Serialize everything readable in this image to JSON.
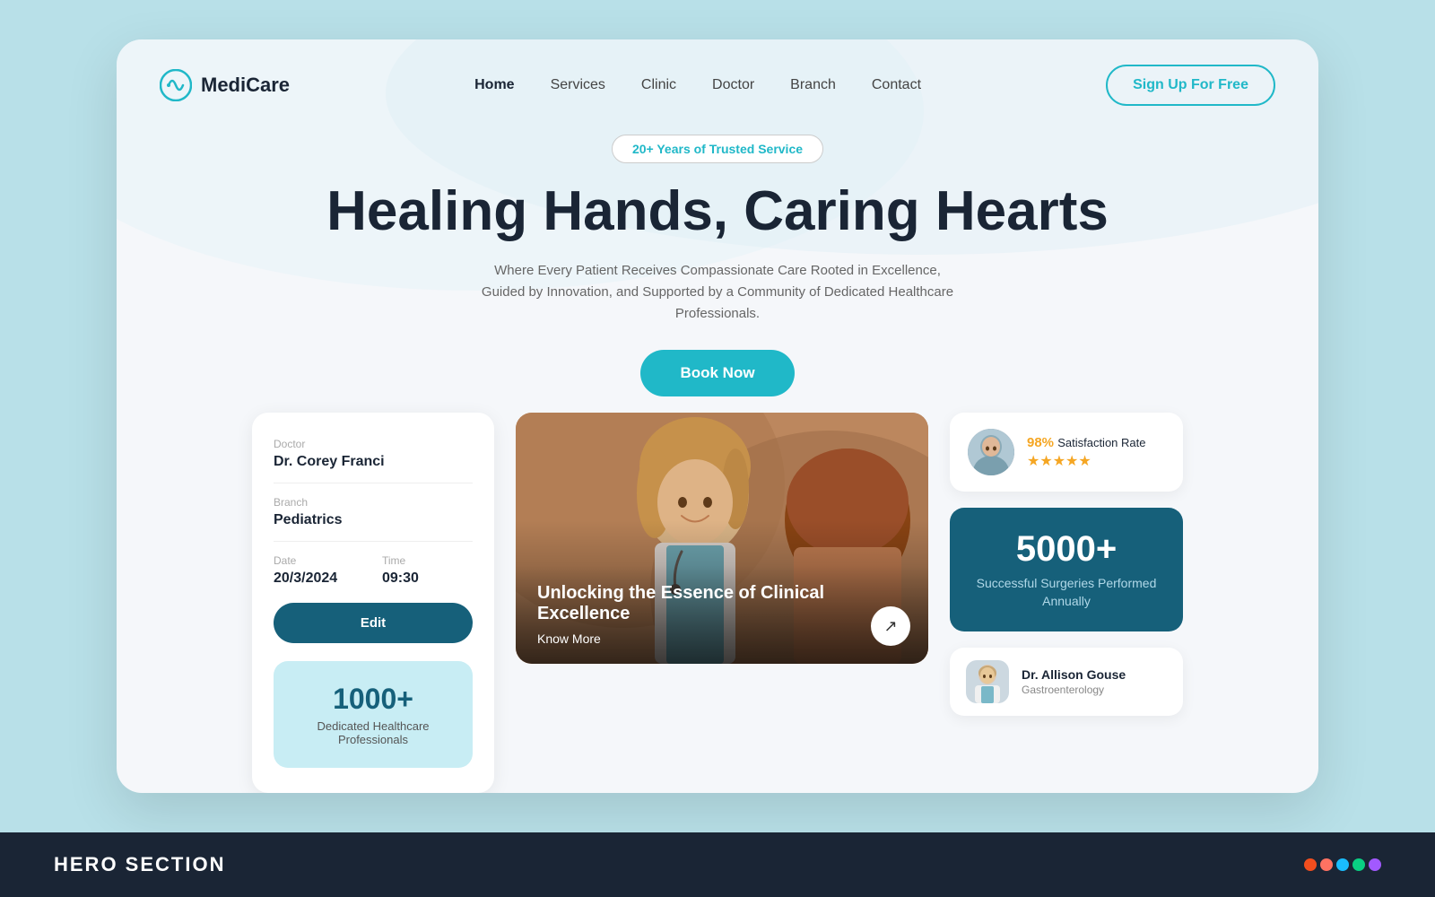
{
  "brand": {
    "name": "MediCare",
    "logo_alt": "MediCare logo"
  },
  "nav": {
    "links": [
      {
        "label": "Home",
        "active": true
      },
      {
        "label": "Services",
        "active": false
      },
      {
        "label": "Clinic",
        "active": false
      },
      {
        "label": "Doctor",
        "active": false
      },
      {
        "label": "Branch",
        "active": false
      },
      {
        "label": "Contact",
        "active": false
      }
    ],
    "signup_label": "Sign Up For Free"
  },
  "hero": {
    "badge": "20+ Years of Trusted Service",
    "title": "Healing Hands, Caring Hearts",
    "subtitle": "Where Every Patient Receives Compassionate Care Rooted in Excellence, Guided by Innovation, and Supported by a Community of Dedicated Healthcare Professionals.",
    "book_label": "Book Now"
  },
  "appointment": {
    "doctor_label": "Doctor",
    "doctor_name": "Dr. Corey Franci",
    "branch_label": "Branch",
    "branch_name": "Pediatrics",
    "date_label": "Date",
    "date_value": "20/3/2024",
    "time_label": "Time",
    "time_value": "09:30",
    "edit_label": "Edit"
  },
  "stats_left": {
    "number": "1000+",
    "label": "Dedicated Healthcare Professionals"
  },
  "image_card": {
    "text": "Unlocking the Essence of Clinical Excellence",
    "know_more": "Know More",
    "arrow": "↗"
  },
  "satisfaction": {
    "percent": "98%",
    "label": "Satisfaction Rate",
    "stars": "★★★★★"
  },
  "surgeries": {
    "number": "5000+",
    "label": "Successful Surgeries Performed Annually"
  },
  "doctor": {
    "name": "Dr. Allison Gouse",
    "specialty": "Gastroenterology"
  },
  "bottom_bar": {
    "title": "HERO SECTION"
  }
}
